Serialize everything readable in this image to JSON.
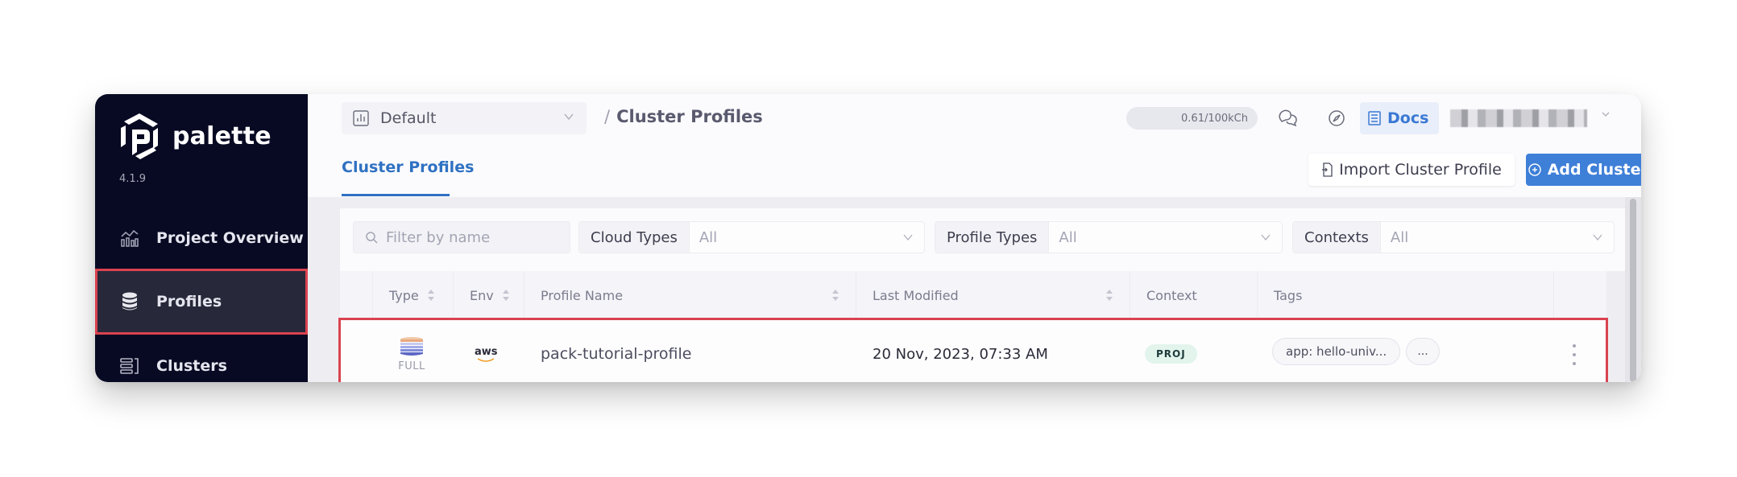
{
  "app": {
    "name": "palette",
    "version": "4.1.9"
  },
  "sidebar": {
    "items": [
      {
        "label": "Project Overview",
        "icon": "chart-icon",
        "active": false
      },
      {
        "label": "Profiles",
        "icon": "database-icon",
        "active": true
      },
      {
        "label": "Clusters",
        "icon": "clusters-icon",
        "active": false
      }
    ]
  },
  "header": {
    "project_select": "Default",
    "breadcrumb_separator": "/",
    "breadcrumb_title": "Cluster Profiles",
    "usage": "0.61/100kCh",
    "docs_label": "Docs"
  },
  "tabs": [
    {
      "label": "Cluster Profiles",
      "active": true
    }
  ],
  "actions": {
    "import_label": "Import Cluster Profile",
    "add_label": "Add Cluster Profile"
  },
  "filters": {
    "search_placeholder": "Filter by name",
    "cloud_types": {
      "label": "Cloud Types",
      "value": "All"
    },
    "profile_types": {
      "label": "Profile Types",
      "value": "All"
    },
    "contexts": {
      "label": "Contexts",
      "value": "All"
    }
  },
  "table": {
    "columns": [
      "Type",
      "Env",
      "Profile Name",
      "Last Modified",
      "Context",
      "Tags"
    ],
    "rows": [
      {
        "type": "FULL",
        "env": "aws",
        "profile_name": "pack-tutorial-profile",
        "last_modified": "20 Nov, 2023, 07:33 AM",
        "context": "PROJ",
        "tag": "app: hello-univ...",
        "more_tags": "..."
      }
    ]
  },
  "colors": {
    "sidebar_bg": "#080a23",
    "accent_blue": "#3e7fd8",
    "highlight_red": "#d9434f",
    "context_badge_bg": "#e2f4ec"
  }
}
